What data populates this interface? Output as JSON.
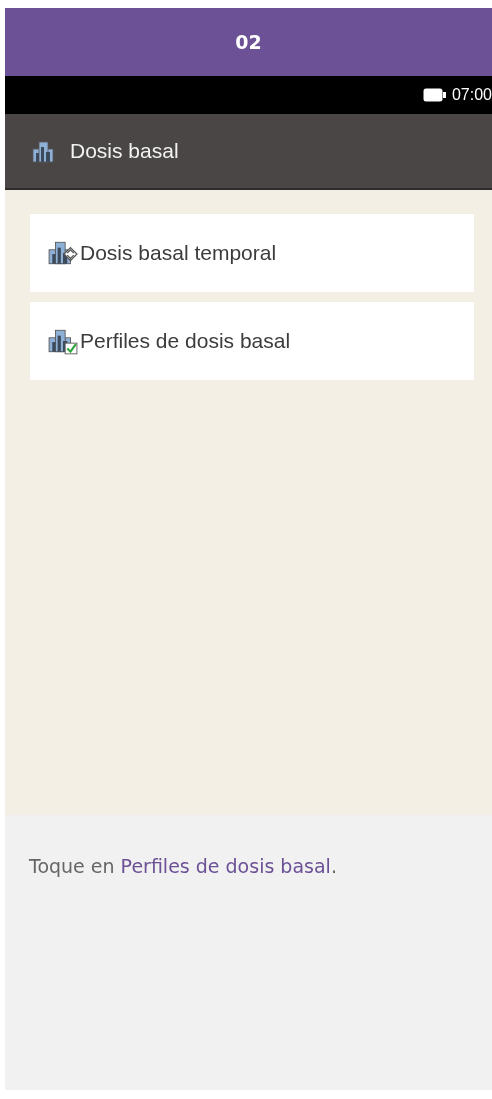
{
  "step": "02",
  "status_bar": {
    "time": "07:00"
  },
  "header": {
    "title": "Dosis basal"
  },
  "menu_items": [
    {
      "label": "Dosis basal temporal",
      "kind": "temporary"
    },
    {
      "label": "Perfiles de dosis basal",
      "kind": "profiles"
    }
  ],
  "instruction": {
    "before": "Toque en ",
    "highlight": "Perfiles de dosis basal",
    "after": "."
  }
}
